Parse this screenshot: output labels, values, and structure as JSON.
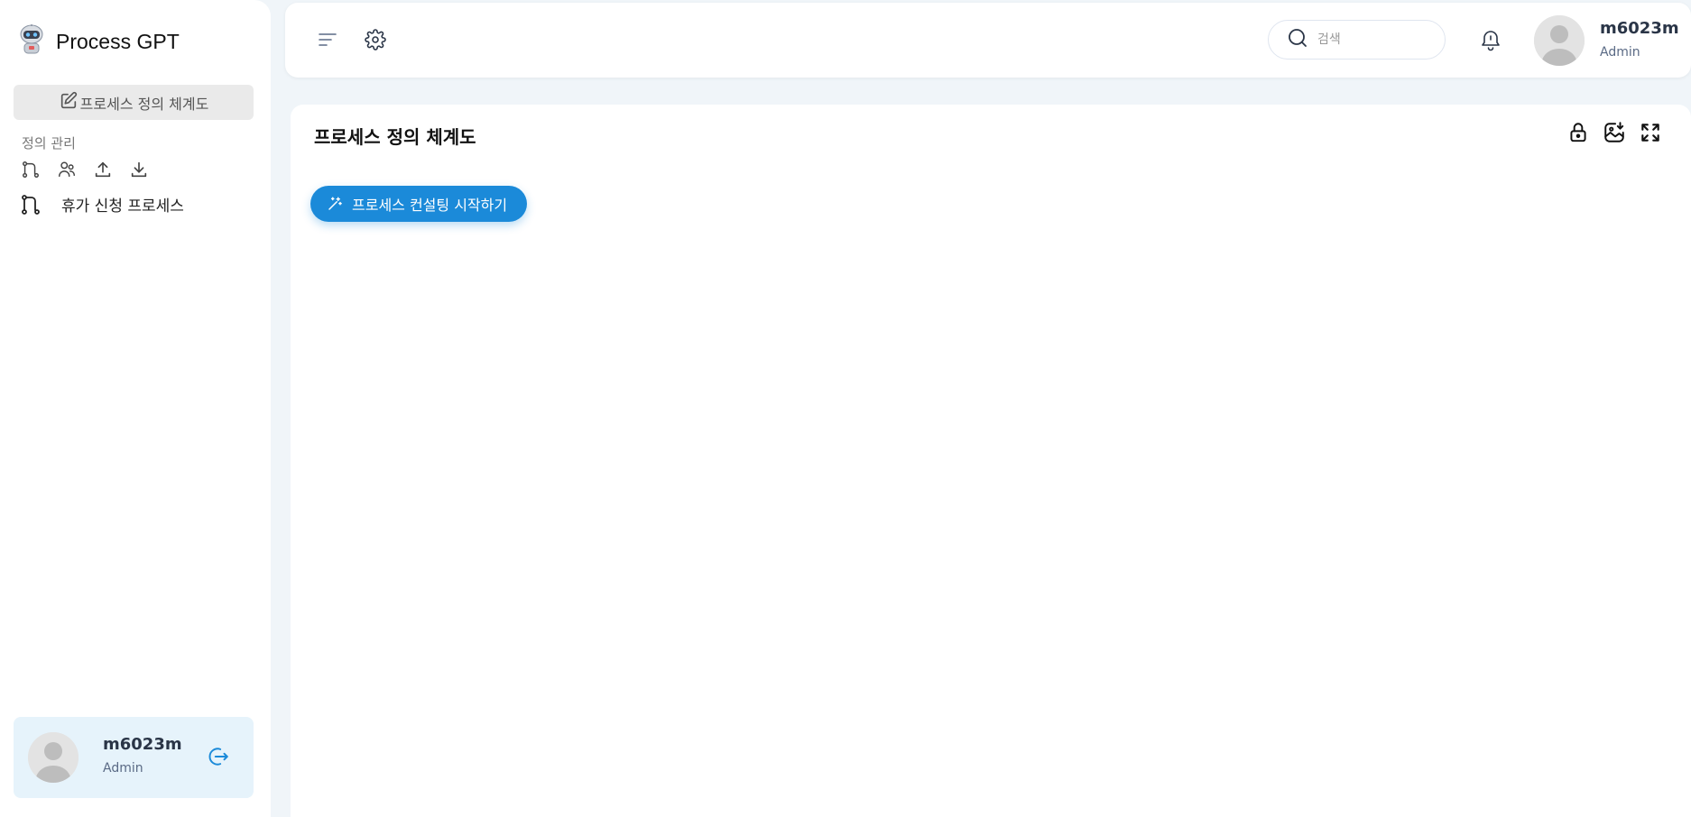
{
  "sidebar": {
    "app_title": "Process GPT",
    "definition_button": "프로세스 정의 체계도",
    "section_label": "정의 관리",
    "process_item": "휴가 신청 프로세스",
    "user": {
      "name": "m6023m",
      "role": "Admin"
    }
  },
  "header": {
    "search_placeholder": "검색",
    "user": {
      "name": "m6023m",
      "role": "Admin"
    }
  },
  "main": {
    "title": "프로세스 정의 체계도",
    "consult_button": "프로세스 컨설팅 시작하기"
  },
  "colors": {
    "accent": "#1b8ad9",
    "user_card_bg": "#e6f3fb",
    "page_bg": "#f0f5f9"
  }
}
